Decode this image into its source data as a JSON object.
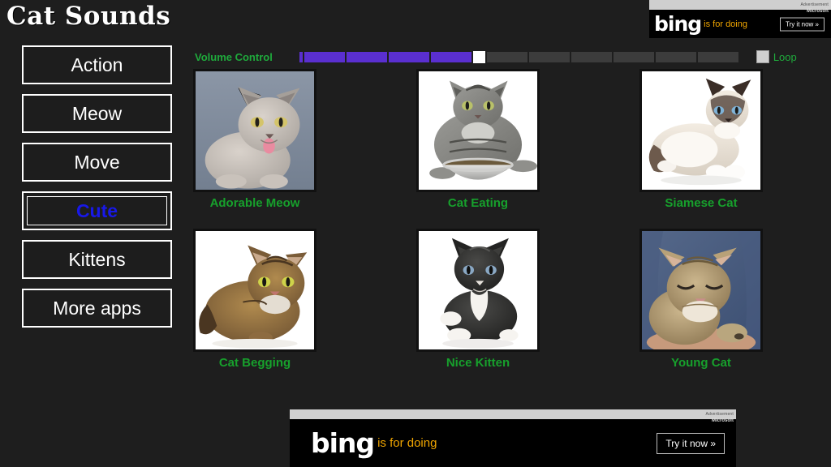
{
  "app": {
    "title": "Cat Sounds",
    "background_color": "#1e1e1e"
  },
  "sidebar": {
    "items": [
      {
        "label": "Action",
        "selected": false
      },
      {
        "label": "Meow",
        "selected": false
      },
      {
        "label": "Move",
        "selected": false
      },
      {
        "label": "Cute",
        "selected": true
      },
      {
        "label": "Kittens",
        "selected": false
      },
      {
        "label": "More apps",
        "selected": false
      }
    ],
    "selected_color": "#1818e8",
    "text_color": "#ffffff"
  },
  "controls": {
    "volume_label": "Volume Control",
    "volume_level": 4,
    "volume_segments": 11,
    "slider_fill_color": "#5a2fd0",
    "slider_empty_color": "#3c3c3c",
    "slider_thumb_color": "#ffffff",
    "loop_label": "Loop",
    "loop_checked": false,
    "accent_color": "#1faa3c"
  },
  "grid": {
    "caption_color": "#17a02c",
    "rows": [
      [
        {
          "caption": "Adorable Meow",
          "image": "grey-kitten-tongue-out"
        },
        {
          "caption": "Cat Eating",
          "image": "tabby-cat-with-food-bowl"
        },
        {
          "caption": "Siamese Cat",
          "image": "siamese-cat-lying-down"
        }
      ],
      [
        {
          "caption": "Cat Begging",
          "image": "longhair-tabby-cat-looking-up"
        },
        {
          "caption": "Nice Kitten",
          "image": "black-and-white-kitten"
        },
        {
          "caption": "Young Cat",
          "image": "sleeping-tabby-kitten"
        }
      ]
    ]
  },
  "ads": {
    "top": {
      "advertisement_label": "Advertisement",
      "provider": "Microsoft",
      "brand": "bing",
      "tagline": "is for doing",
      "cta": "Try it now »"
    },
    "bottom": {
      "advertisement_label": "Advertisement",
      "provider": "Microsoft",
      "brand": "bing",
      "tagline": "is for doing",
      "cta": "Try it now »"
    }
  }
}
